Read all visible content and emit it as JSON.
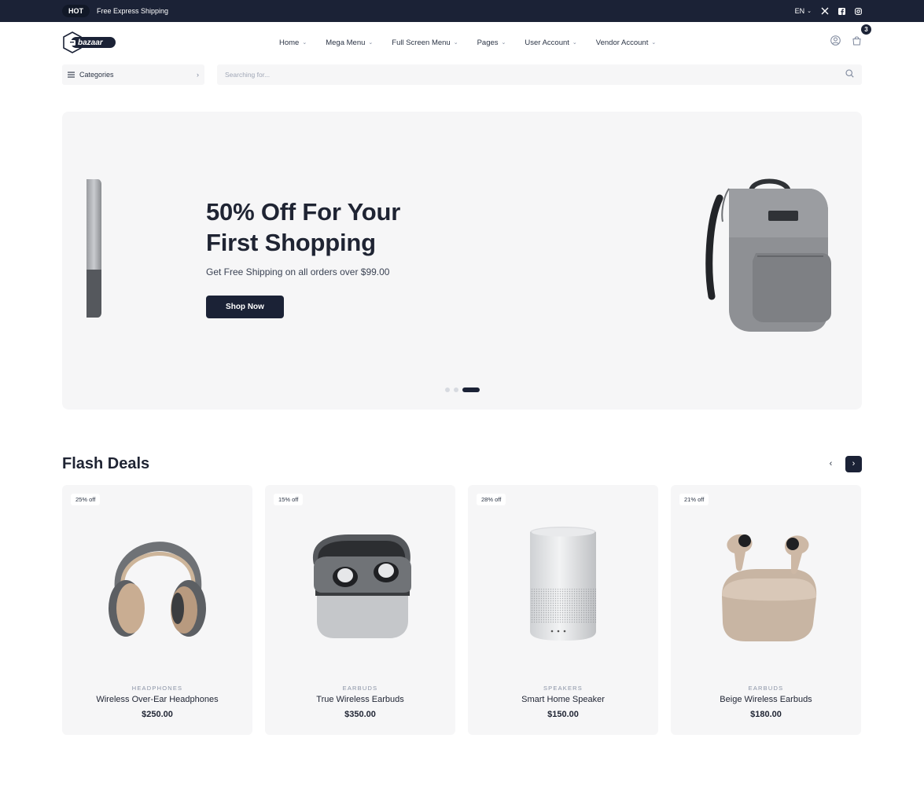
{
  "topbar": {
    "hot_label": "HOT",
    "promo_text": "Free Express Shipping",
    "language": "EN"
  },
  "header": {
    "logo_text": "bazaar",
    "nav": [
      {
        "label": "Home"
      },
      {
        "label": "Mega Menu"
      },
      {
        "label": "Full Screen Menu"
      },
      {
        "label": "Pages"
      },
      {
        "label": "User Account"
      },
      {
        "label": "Vendor Account"
      }
    ],
    "cart_count": "3"
  },
  "search": {
    "categories_label": "Categories",
    "placeholder": "Searching for..."
  },
  "hero": {
    "title_line1": "50% Off For Your",
    "title_line2": "First Shopping",
    "subtitle": "Get Free Shipping on all orders over $99.00",
    "button_label": "Shop Now",
    "active_slide": 3,
    "slide_count": 3
  },
  "flash_deals": {
    "title": "Flash Deals",
    "products": [
      {
        "badge": "25% off",
        "category": "HEADPHONES",
        "name": "Wireless Over-Ear Headphones",
        "price": "$250.00",
        "icon": "headphones-icon"
      },
      {
        "badge": "15% off",
        "category": "EARBUDS",
        "name": "True Wireless Earbuds",
        "price": "$350.00",
        "icon": "earbuds-case-icon"
      },
      {
        "badge": "28% off",
        "category": "SPEAKERS",
        "name": "Smart Home Speaker",
        "price": "$150.00",
        "icon": "smart-speaker-icon"
      },
      {
        "badge": "21% off",
        "category": "EARBUDS",
        "name": "Beige Wireless Earbuds",
        "price": "$180.00",
        "icon": "beige-earbuds-icon"
      }
    ]
  },
  "colors": {
    "dark_navy": "#1b2236",
    "card_bg": "#f6f6f7"
  }
}
